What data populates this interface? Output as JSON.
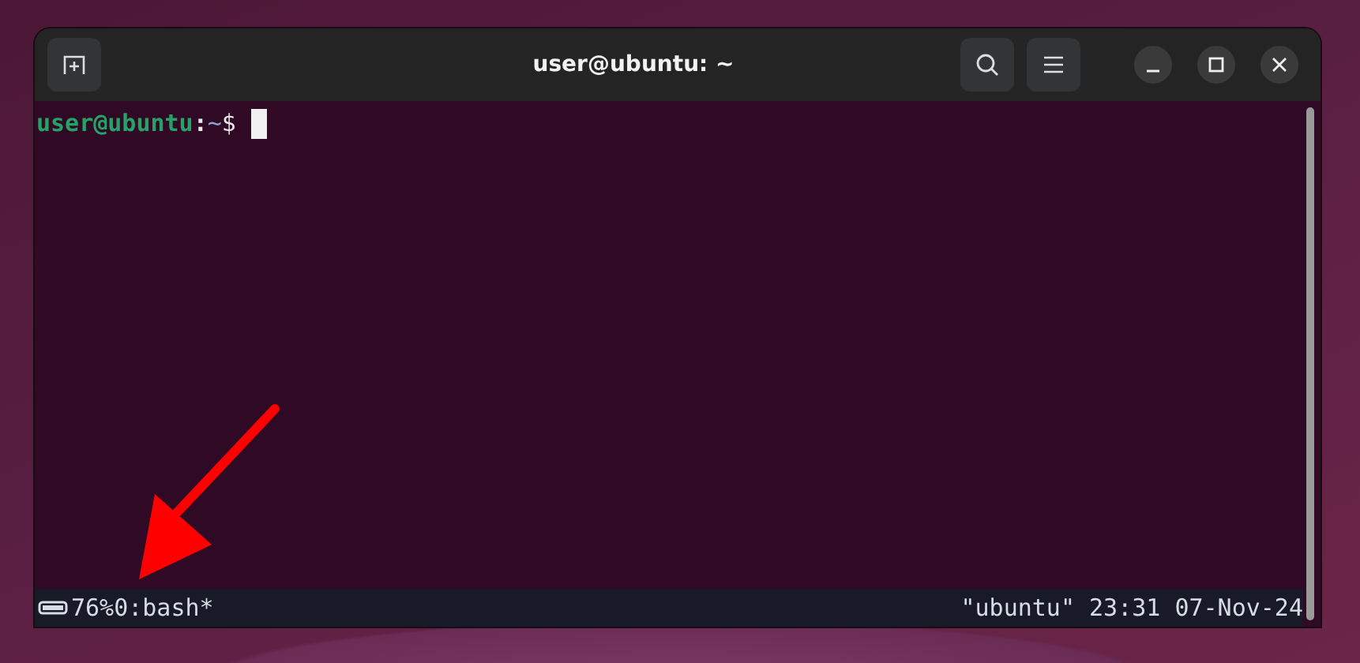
{
  "window": {
    "title": "user@ubuntu: ~"
  },
  "terminal": {
    "prompt": {
      "user_host": "user@ubuntu",
      "separator": ":",
      "path": "~",
      "symbol": "$"
    }
  },
  "status_bar": {
    "battery": "76%",
    "window_list": "0:bash*",
    "right": "\"ubuntu\" 23:31 07-Nov-24"
  }
}
